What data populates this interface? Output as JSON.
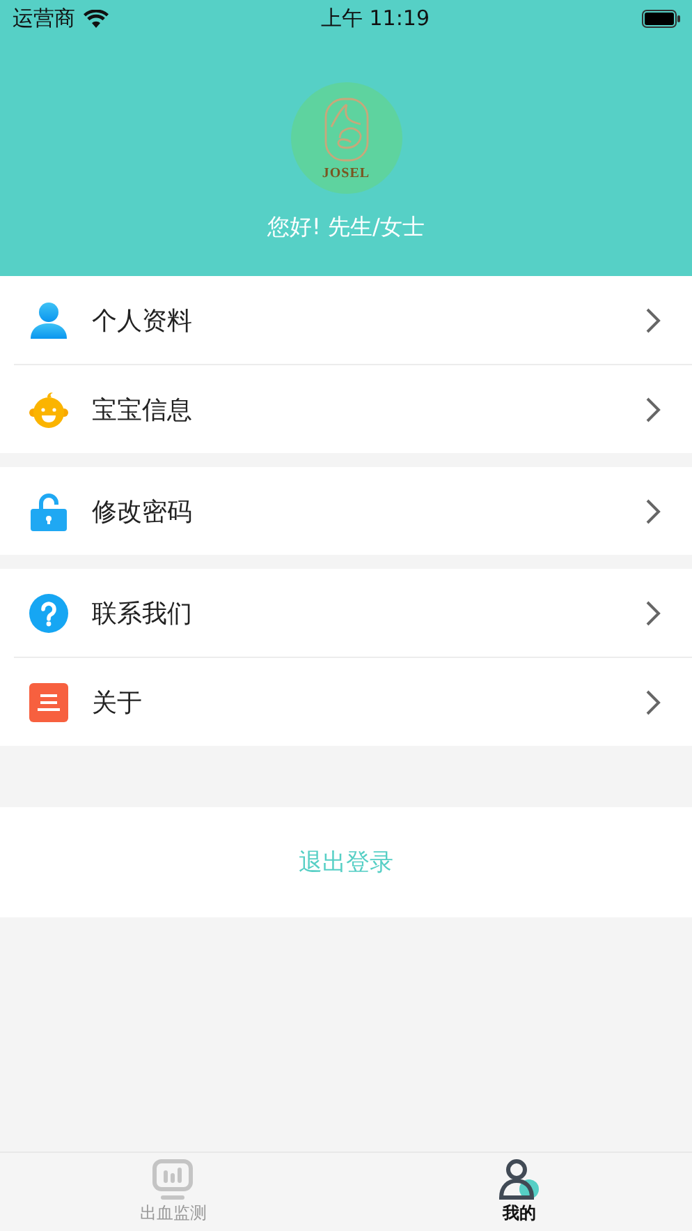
{
  "status_bar": {
    "carrier": "运营商",
    "time": "上午 11:19"
  },
  "profile": {
    "logo_text": "JOSEL",
    "greeting": "您好!  先生/女士"
  },
  "menu_groups": [
    {
      "items": [
        {
          "label": "个人资料",
          "kind": "person"
        },
        {
          "label": "宝宝信息",
          "kind": "baby"
        }
      ]
    },
    {
      "items": [
        {
          "label": "修改密码",
          "kind": "lock"
        }
      ]
    },
    {
      "items": [
        {
          "label": "联系我们",
          "kind": "help"
        },
        {
          "label": "关于",
          "kind": "about"
        }
      ]
    }
  ],
  "logout": {
    "label": "退出登录"
  },
  "tab_bar": [
    {
      "label": "出血监测",
      "kind": "monitor",
      "selected": false
    },
    {
      "label": "我的",
      "kind": "me",
      "selected": true
    }
  ]
}
